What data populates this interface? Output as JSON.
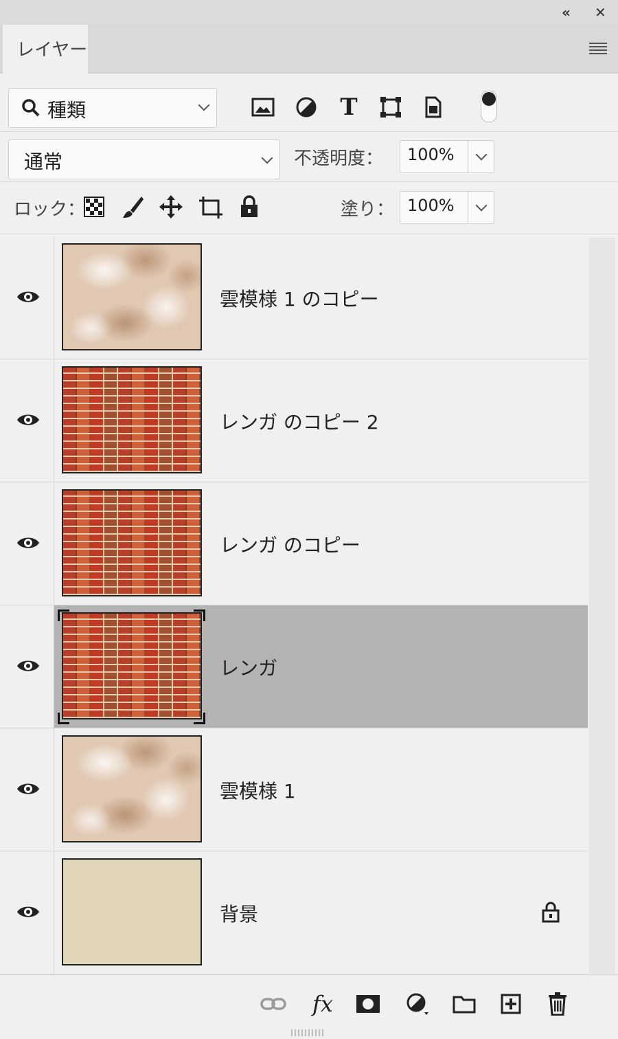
{
  "panel": {
    "tab_label": "レイヤー",
    "collapse_glyph": "«",
    "close_glyph": "✕"
  },
  "filter": {
    "kind_label": "種類",
    "icons": [
      "image-filter-icon",
      "adjustment-filter-icon",
      "type-filter-icon",
      "shape-filter-icon",
      "smart-object-filter-icon"
    ],
    "type_glyph": "T"
  },
  "blend": {
    "mode": "通常",
    "opacity_label": "不透明度：",
    "opacity_value": "100%"
  },
  "lock": {
    "label": "ロック：",
    "fill_label": "塗り：",
    "fill_value": "100%"
  },
  "layers": [
    {
      "name": "雲模様 1 のコピー",
      "visible": true,
      "thumb": "cloud",
      "selected": false,
      "locked": false
    },
    {
      "name": "レンガ のコピー 2",
      "visible": true,
      "thumb": "brick",
      "selected": false,
      "locked": false
    },
    {
      "name": "レンガ のコピー",
      "visible": true,
      "thumb": "brick",
      "selected": false,
      "locked": false
    },
    {
      "name": "レンガ",
      "visible": true,
      "thumb": "brick",
      "selected": true,
      "locked": false
    },
    {
      "name": "雲模様 1",
      "visible": true,
      "thumb": "cloud",
      "selected": false,
      "locked": false
    },
    {
      "name": "背景",
      "visible": true,
      "thumb": "solid",
      "selected": false,
      "locked": true
    }
  ],
  "footer": {
    "fx_label": "fx"
  },
  "colors": {
    "selected_row": "#b3b3b3",
    "panel_bg": "#f0f0f0",
    "background_swatch": "#e0d5b8"
  }
}
